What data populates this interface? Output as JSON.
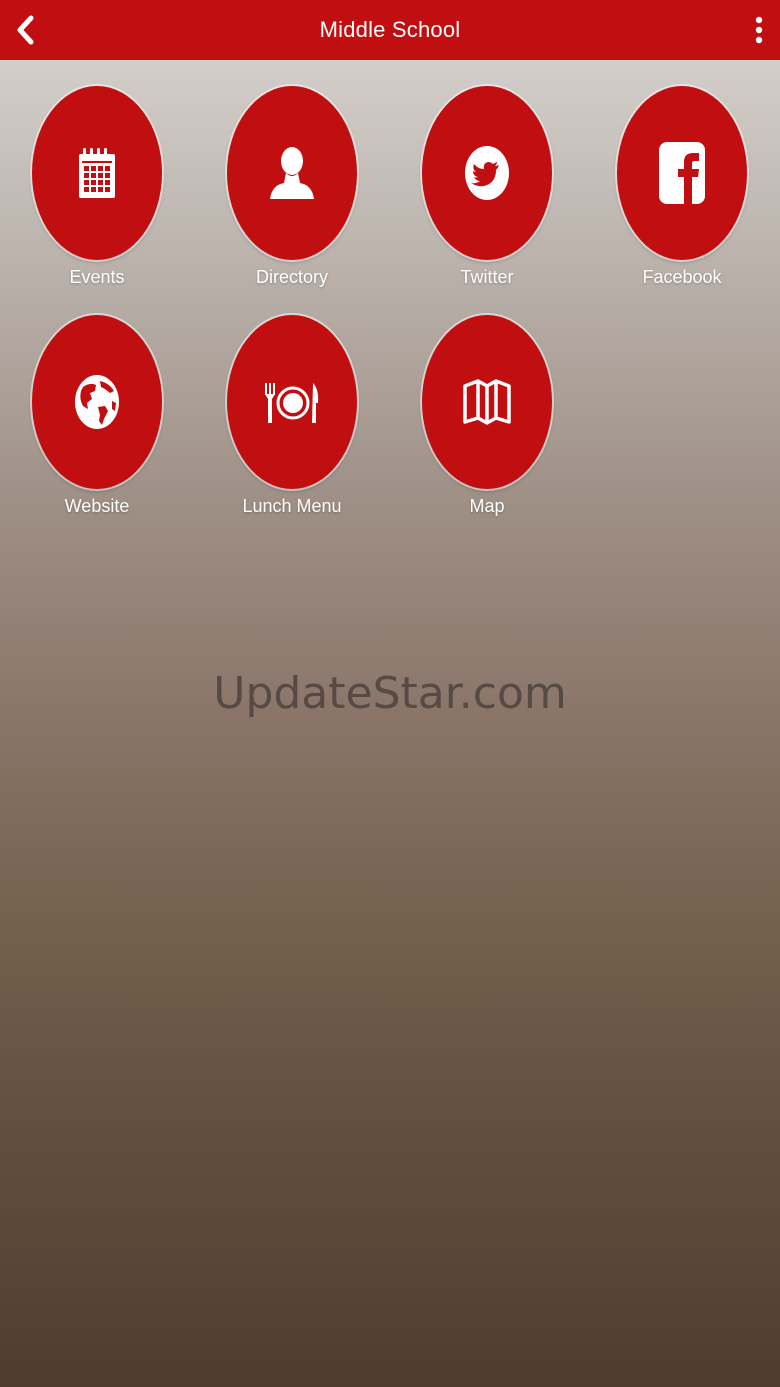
{
  "header": {
    "title": "Middle School",
    "back_icon": "chevron-left-icon",
    "menu_icon": "more-vertical-icon",
    "color": "#c10e10"
  },
  "tiles": [
    {
      "label": "Events",
      "icon": "calendar-icon"
    },
    {
      "label": "Directory",
      "icon": "person-icon"
    },
    {
      "label": "Twitter",
      "icon": "twitter-icon"
    },
    {
      "label": "Facebook",
      "icon": "facebook-icon"
    },
    {
      "label": "Website",
      "icon": "globe-icon"
    },
    {
      "label": "Lunch Menu",
      "icon": "dining-icon"
    },
    {
      "label": "Map",
      "icon": "map-icon"
    }
  ],
  "watermark": "UpdateStar.com"
}
